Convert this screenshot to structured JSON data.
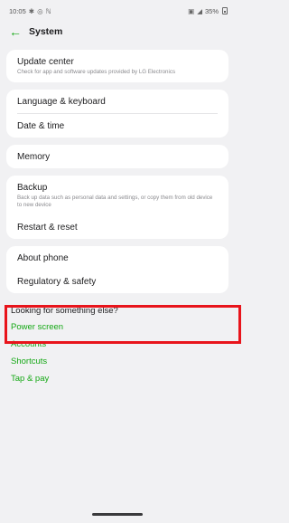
{
  "status_bar": {
    "time": "10:05",
    "icons_left": [
      "gear-icon",
      "location-icon",
      "nfc-icon"
    ],
    "battery_text": "35%",
    "icons_right": [
      "sim-icon",
      "signal-icon",
      "battery-icon"
    ]
  },
  "header": {
    "title": "System"
  },
  "cards": [
    {
      "items": [
        {
          "title": "Update center",
          "subtitle": "Check for app and software updates provided by LG Electronics"
        }
      ]
    },
    {
      "items": [
        {
          "title": "Language & keyboard"
        },
        {
          "title": "Date & time"
        }
      ]
    },
    {
      "items": [
        {
          "title": "Memory"
        }
      ]
    },
    {
      "items": [
        {
          "title": "Backup",
          "subtitle": "Back up data such as personal data and settings, or copy them from old device to new device"
        },
        {
          "title": "Restart & reset"
        }
      ]
    },
    {
      "items": [
        {
          "title": "About phone"
        },
        {
          "title": "Regulatory & safety"
        }
      ]
    }
  ],
  "looking": {
    "title": "Looking for something else?",
    "links": [
      "Power screen",
      "Accounts",
      "Shortcuts",
      "Tap & pay"
    ]
  },
  "colors": {
    "accent": "#15a815",
    "highlight": "#e8141b",
    "background": "#f1f1f3",
    "card": "#ffffff"
  }
}
